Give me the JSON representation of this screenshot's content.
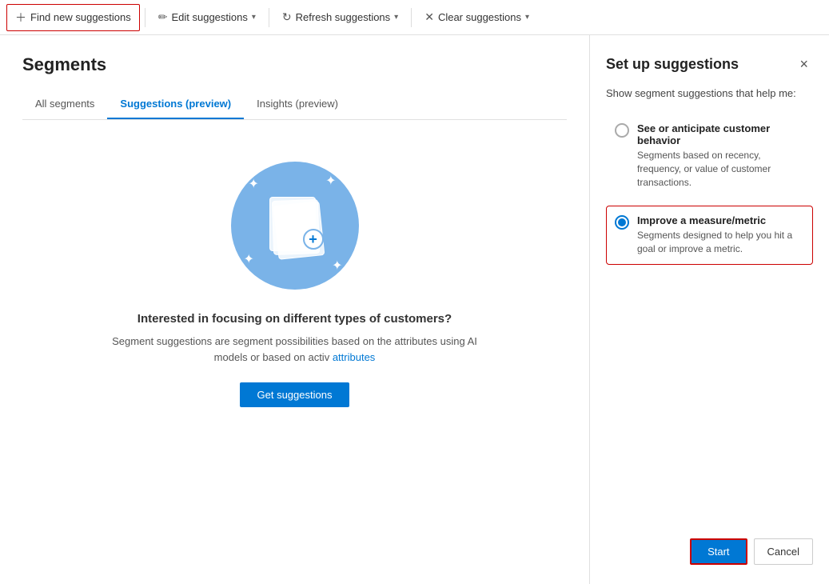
{
  "toolbar": {
    "find_label": "Find new suggestions",
    "edit_label": "Edit suggestions",
    "refresh_label": "Refresh suggestions",
    "clear_label": "Clear suggestions"
  },
  "page": {
    "title": "Segments",
    "tabs": [
      {
        "label": "All segments",
        "active": false
      },
      {
        "label": "Suggestions (preview)",
        "active": true
      },
      {
        "label": "Insights (preview)",
        "active": false
      }
    ]
  },
  "illustration": {
    "title": "Interested in focusing on different types of customers?",
    "description": "Segment suggestions are segment possibilities based on the attributes using AI models or based on activ",
    "get_suggestions_label": "Get suggestions"
  },
  "panel": {
    "title": "Set up suggestions",
    "subtitle": "Show segment suggestions that help me:",
    "close_icon": "×",
    "options": [
      {
        "label": "See or anticipate customer behavior",
        "description": "Segments based on recency, frequency, or value of customer transactions.",
        "selected": false
      },
      {
        "label": "Improve a measure/metric",
        "description": "Segments designed to help you hit a goal or improve a metric.",
        "selected": true
      }
    ],
    "start_label": "Start",
    "cancel_label": "Cancel"
  }
}
